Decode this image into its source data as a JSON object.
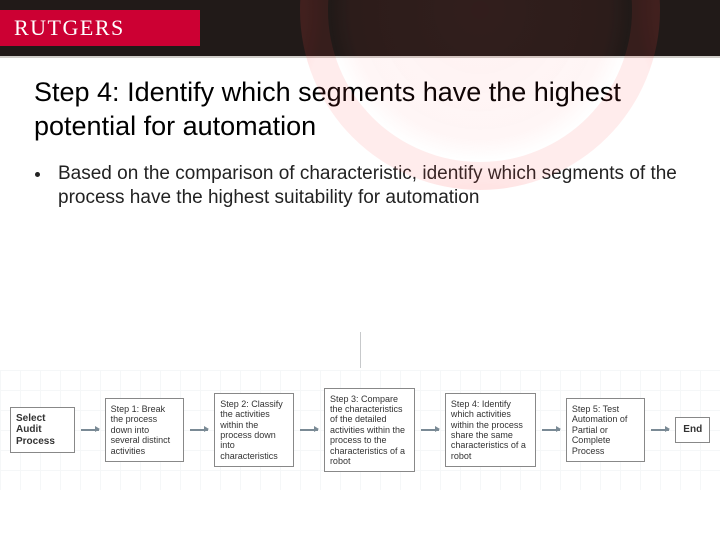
{
  "brand": {
    "logo_text": "RUTGERS"
  },
  "title": "Step 4: Identify which segments have the highest potential for automation",
  "bullets": [
    "Based on the comparison of characteristic, identify which segments of the process have the highest suitability for automation"
  ],
  "flow": {
    "start": "Select Audit Process",
    "steps": [
      "Step 1: Break the process down into several distinct activities",
      "Step 2: Classify the activities within the process down into characteristics",
      "Step 3: Compare the characteristics of the detailed activities within the process to the characteristics of a robot",
      "Step 4: Identify which activities within the process share the same characteristics of a robot",
      "Step 5: Test Automation of Partial or Complete Process"
    ],
    "end": "End"
  }
}
